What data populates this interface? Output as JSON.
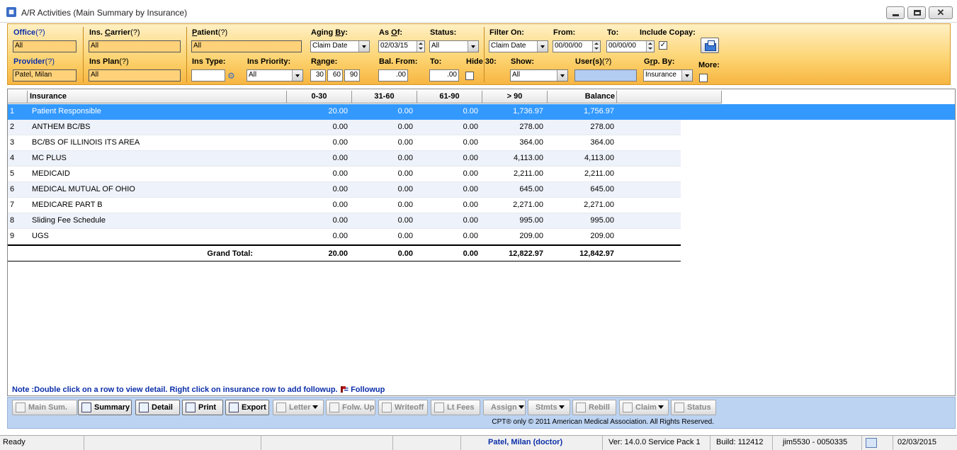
{
  "window": {
    "title": "A/R Activities  (Main Summary by Insurance)"
  },
  "filters": {
    "office": {
      "label": "Office",
      "help": "(?)",
      "value": "All"
    },
    "provider": {
      "label": "Provider",
      "help": "(?)",
      "value": "Patel, Milan"
    },
    "ins_carrier": {
      "label_pre": "Ins. ",
      "label_key": "C",
      "label_post": "arrier",
      "help": "(?)",
      "value": "All"
    },
    "ins_plan": {
      "label": "Ins Plan",
      "help": "(?)",
      "value": "All"
    },
    "patient": {
      "label_key": "P",
      "label_post": "atient",
      "help": "(?)",
      "value": "All"
    },
    "ins_type": {
      "label": "Ins Type:",
      "value": ""
    },
    "ins_priority": {
      "label": "Ins Priority:",
      "value": "All"
    },
    "aging_by": {
      "label_pre": "Aging ",
      "label_key": "B",
      "label_post": "y:",
      "value": "Claim Date"
    },
    "range": {
      "label_pre": "R",
      "label_key": "a",
      "label_post": "nge:",
      "values": [
        "30",
        "60",
        "90"
      ]
    },
    "as_of": {
      "label_pre": "As ",
      "label_key": "O",
      "label_post": "f:",
      "value": "02/03/15"
    },
    "bal_from": {
      "label": "Bal. From:",
      "value": ".00"
    },
    "status": {
      "label": "Status:",
      "value": "All"
    },
    "to_bal": {
      "label": "To:",
      "value": ".00"
    },
    "hide30": {
      "label": "Hide 30:",
      "checked": false
    },
    "filter_on": {
      "label": "Filter On:",
      "value": "Claim Date"
    },
    "show": {
      "label": "Show:",
      "value": "All"
    },
    "from_date": {
      "label": "From:",
      "value": "00/00/00"
    },
    "to_date": {
      "label": "To:",
      "value": "00/00/00"
    },
    "users": {
      "label": "User(s)",
      "help": "(?)",
      "value": ""
    },
    "include_copay": {
      "label": "Include Copay:",
      "checked": true,
      "mark": "✓"
    },
    "grp_by": {
      "label_pre": "G",
      "label_key": "r",
      "label_post": "p. By:",
      "value": "Insurance"
    },
    "more": {
      "label": "More:",
      "checked": false
    }
  },
  "table": {
    "columns": [
      "Insurance",
      "0-30",
      "31-60",
      "61-90",
      "> 90",
      "Balance"
    ],
    "rows": [
      {
        "num": "1",
        "insurance": "Patient Responsible",
        "d0_30": "20.00",
        "d31_60": "0.00",
        "d61_90": "0.00",
        "d90": "1,736.97",
        "balance": "1,756.97"
      },
      {
        "num": "2",
        "insurance": "ANTHEM BC/BS",
        "d0_30": "0.00",
        "d31_60": "0.00",
        "d61_90": "0.00",
        "d90": "278.00",
        "balance": "278.00"
      },
      {
        "num": "3",
        "insurance": "BC/BS OF ILLINOIS ITS AREA",
        "d0_30": "0.00",
        "d31_60": "0.00",
        "d61_90": "0.00",
        "d90": "364.00",
        "balance": "364.00"
      },
      {
        "num": "4",
        "insurance": "MC PLUS",
        "d0_30": "0.00",
        "d31_60": "0.00",
        "d61_90": "0.00",
        "d90": "4,113.00",
        "balance": "4,113.00"
      },
      {
        "num": "5",
        "insurance": "MEDICAID",
        "d0_30": "0.00",
        "d31_60": "0.00",
        "d61_90": "0.00",
        "d90": "2,211.00",
        "balance": "2,211.00"
      },
      {
        "num": "6",
        "insurance": "MEDICAL MUTUAL OF OHIO",
        "d0_30": "0.00",
        "d31_60": "0.00",
        "d61_90": "0.00",
        "d90": "645.00",
        "balance": "645.00"
      },
      {
        "num": "7",
        "insurance": "MEDICARE PART B",
        "d0_30": "0.00",
        "d31_60": "0.00",
        "d61_90": "0.00",
        "d90": "2,271.00",
        "balance": "2,271.00"
      },
      {
        "num": "8",
        "insurance": "Sliding Fee Schedule",
        "d0_30": "0.00",
        "d31_60": "0.00",
        "d61_90": "0.00",
        "d90": "995.00",
        "balance": "995.00"
      },
      {
        "num": "9",
        "insurance": "UGS",
        "d0_30": "0.00",
        "d31_60": "0.00",
        "d61_90": "0.00",
        "d90": "209.00",
        "balance": "209.00"
      }
    ],
    "selected_row": 0,
    "total": {
      "label": "Grand Total:",
      "d0_30": "20.00",
      "d31_60": "0.00",
      "d61_90": "0.00",
      "d90": "12,822.97",
      "balance": "12,842.97"
    }
  },
  "note": {
    "text": "Note :Double click on a row to view detail. Right click on insurance row to add followup.",
    "legend": "= Followup"
  },
  "toolbar": {
    "buttons": [
      {
        "id": "main-sum",
        "label": "Main Sum.",
        "enabled": false,
        "dropdown": false,
        "icon": "chart-icon"
      },
      {
        "id": "summary",
        "label": "Summary",
        "enabled": true,
        "dropdown": false,
        "icon": "summary-icon"
      },
      {
        "id": "detail",
        "label": "Detail",
        "enabled": true,
        "dropdown": false,
        "icon": "detail-icon"
      },
      {
        "id": "print",
        "label": "Print",
        "enabled": true,
        "dropdown": false,
        "icon": "printer-icon"
      },
      {
        "id": "export",
        "label": "Export",
        "enabled": true,
        "dropdown": false,
        "icon": "export-icon"
      },
      {
        "id": "letter",
        "label": "Letter",
        "enabled": false,
        "dropdown": true,
        "icon": "letter-icon"
      },
      {
        "id": "folw-up",
        "label": "Folw. Up",
        "enabled": false,
        "dropdown": false,
        "icon": "flag-icon"
      },
      {
        "id": "writeoff",
        "label": "Writeoff",
        "enabled": false,
        "dropdown": false,
        "icon": "writeoff-icon"
      },
      {
        "id": "lt-fees",
        "label": "Lt Fees",
        "enabled": false,
        "dropdown": false,
        "icon": "late-fee-icon"
      },
      {
        "id": "assign",
        "label": "Assign",
        "enabled": false,
        "dropdown": true,
        "icon": ""
      },
      {
        "id": "stmts",
        "label": "Stmts",
        "enabled": false,
        "dropdown": true,
        "icon": ""
      },
      {
        "id": "rebill",
        "label": "Rebill",
        "enabled": false,
        "dropdown": false,
        "icon": "rebill-icon"
      },
      {
        "id": "claim",
        "label": "Claim",
        "enabled": false,
        "dropdown": true,
        "icon": "claim-icon"
      },
      {
        "id": "status",
        "label": "Status",
        "enabled": false,
        "dropdown": false,
        "icon": "pencil-icon"
      }
    ],
    "copyright": "CPT® only © 2011 American Medical Association.  All Rights Reserved."
  },
  "statusbar": {
    "ready": "Ready",
    "user": "Patel, Milan (doctor)",
    "version": "Ver: 14.0.0 Service Pack 1",
    "build": "Build: 112412",
    "session": "jim5530 - 0050335",
    "date": "02/03/2015"
  },
  "colors": {
    "filter_panel": "#fcd26e",
    "selected_row": "#3399ff",
    "label_blue": "#0b2ea8",
    "toolbar_bg": "#bcd3f2"
  }
}
